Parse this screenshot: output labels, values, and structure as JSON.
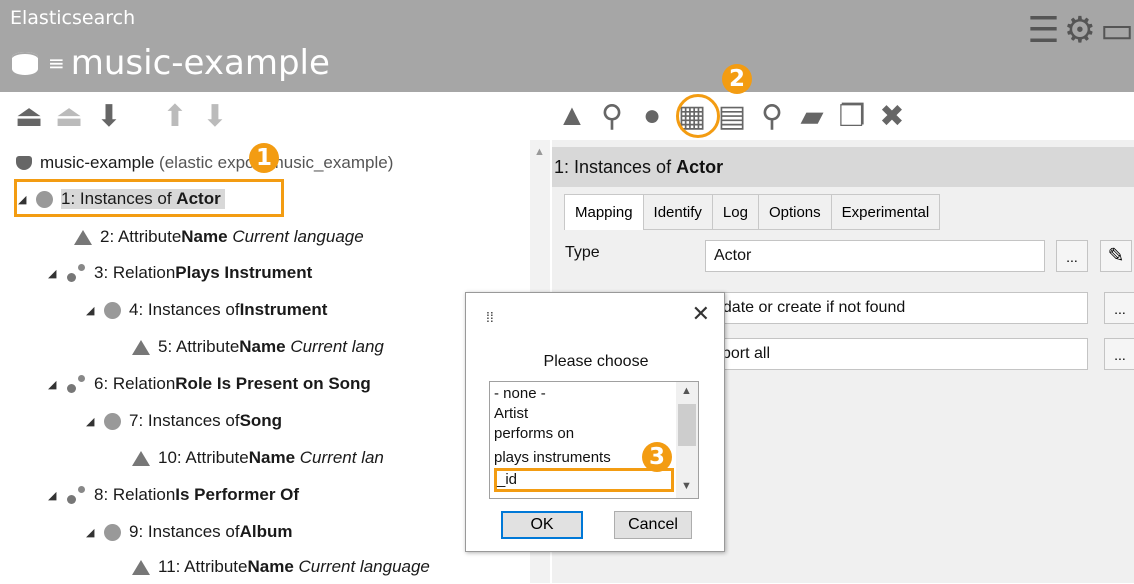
{
  "header": {
    "app_name": "Elasticsearch",
    "title": "music-example"
  },
  "tree": {
    "root_label": "music-example",
    "root_sub": "(elastic export.music_example)",
    "rows": [
      {
        "prefix": "1: Instances of ",
        "bold": "Actor",
        "italic": ""
      },
      {
        "prefix": "2: Attribute ",
        "bold": "Name",
        "italic": "Current language"
      },
      {
        "prefix": "3: Relation ",
        "bold": "Plays Instrument",
        "italic": ""
      },
      {
        "prefix": "4: Instances of ",
        "bold": "Instrument",
        "italic": ""
      },
      {
        "prefix": "5: Attribute ",
        "bold": "Name",
        "italic": "Current lang"
      },
      {
        "prefix": "6: Relation ",
        "bold": "Role Is Present on Song",
        "italic": ""
      },
      {
        "prefix": "7: Instances of ",
        "bold": "Song",
        "italic": ""
      },
      {
        "prefix": "10: Attribute ",
        "bold": "Name",
        "italic": "Current lan"
      },
      {
        "prefix": "8: Relation ",
        "bold": "Is Performer Of",
        "italic": ""
      },
      {
        "prefix": "9: Instances of ",
        "bold": "Album",
        "italic": ""
      },
      {
        "prefix": "11: Attribute ",
        "bold": "Name",
        "italic": "Current language"
      }
    ]
  },
  "panel": {
    "header_prefix": "1: Instances of ",
    "header_bold": "Actor",
    "tabs": [
      "Mapping",
      "Identify",
      "Log",
      "Options",
      "Experimental"
    ],
    "type_label": "Type",
    "type_value": "Actor",
    "field2_value": "pdate or create if not found",
    "field3_value": "xport all",
    "ellipsis": "..."
  },
  "dialog": {
    "message": "Please choose",
    "options": [
      "- none -",
      "Artist",
      "performs on",
      "plays instruments",
      "_id"
    ],
    "selected": "_id",
    "ok_label": "OK",
    "cancel_label": "Cancel"
  },
  "badges": [
    "1",
    "2",
    "3"
  ],
  "accent_color": "#f39c12"
}
